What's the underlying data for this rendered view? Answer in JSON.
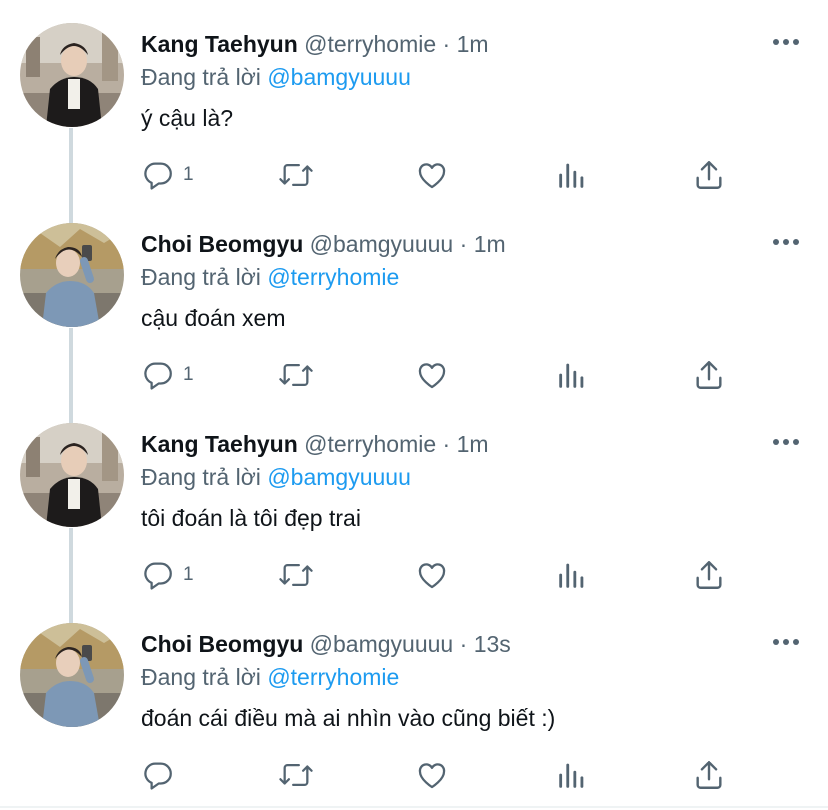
{
  "tweets": [
    {
      "name": "Kang Taehyun",
      "handle": "@terryhomie",
      "sep": "·",
      "time": "1m",
      "reply_prefix": "Đang trả lời",
      "reply_to": "@bamgyuuuu",
      "text": "ý cậu là?",
      "reply_count": "1",
      "avatar": "avatar-taehyun"
    },
    {
      "name": "Choi Beomgyu",
      "handle": "@bamgyuuuu",
      "sep": "·",
      "time": "1m",
      "reply_prefix": "Đang trả lời",
      "reply_to": "@terryhomie",
      "text": "cậu đoán xem",
      "reply_count": "1",
      "avatar": "avatar-beomgyu"
    },
    {
      "name": "Kang Taehyun",
      "handle": "@terryhomie",
      "sep": "·",
      "time": "1m",
      "reply_prefix": "Đang trả lời",
      "reply_to": "@bamgyuuuu",
      "text": "tôi đoán là tôi đẹp trai",
      "reply_count": "1",
      "avatar": "avatar-taehyun"
    },
    {
      "name": "Choi Beomgyu",
      "handle": "@bamgyuuuu",
      "sep": "·",
      "time": "13s",
      "reply_prefix": "Đang trả lời",
      "reply_to": "@terryhomie",
      "text": "đoán cái điều mà ai nhìn vào cũng biết :)",
      "reply_count": "",
      "avatar": "avatar-beomgyu"
    }
  ],
  "icons": {
    "reply": "reply-icon",
    "retweet": "retweet-icon",
    "like": "heart-icon",
    "stats": "analytics-icon",
    "share": "share-icon",
    "more": "more-icon"
  },
  "colors": {
    "text": "#0f1419",
    "secondary": "#536471",
    "mention": "#1d9bf0",
    "thread_line": "#cfd9de"
  }
}
